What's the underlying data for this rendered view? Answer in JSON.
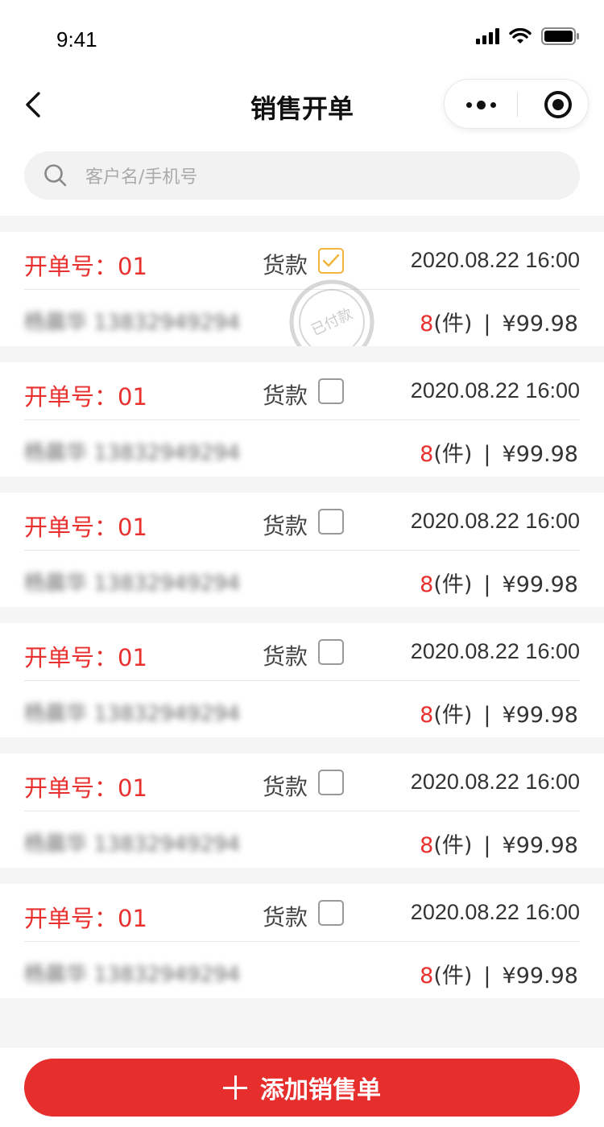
{
  "status_bar": {
    "time": "9:41",
    "icons": [
      "signal-icon",
      "wifi-icon",
      "battery-icon"
    ]
  },
  "nav": {
    "title": "销售开单",
    "icons": [
      "back-icon",
      "more-icon",
      "close-mini-program-icon"
    ]
  },
  "search": {
    "placeholder": "客户名/手机号",
    "icon": "search-icon"
  },
  "orders": [
    {
      "order_label": "开单号：01",
      "payment_label": "货款",
      "paid": true,
      "stamp": "已付款",
      "date": "2020.08.22 16:00",
      "customer": "杨晨华  13832949294",
      "qty": "8",
      "unit": "(件)",
      "separator": "|",
      "amount": "¥99.98"
    },
    {
      "order_label": "开单号：01",
      "payment_label": "货款",
      "paid": false,
      "date": "2020.08.22 16:00",
      "customer": "杨晨华  13832949294",
      "qty": "8",
      "unit": "(件)",
      "separator": "|",
      "amount": "¥99.98"
    },
    {
      "order_label": "开单号：01",
      "payment_label": "货款",
      "paid": false,
      "date": "2020.08.22 16:00",
      "customer": "杨晨华  13832949294",
      "qty": "8",
      "unit": "(件)",
      "separator": "|",
      "amount": "¥99.98"
    },
    {
      "order_label": "开单号：01",
      "payment_label": "货款",
      "paid": false,
      "date": "2020.08.22 16:00",
      "customer": "杨晨华  13832949294",
      "qty": "8",
      "unit": "(件)",
      "separator": "|",
      "amount": "¥99.98"
    },
    {
      "order_label": "开单号：01",
      "payment_label": "货款",
      "paid": false,
      "date": "2020.08.22 16:00",
      "customer": "杨晨华  13832949294",
      "qty": "8",
      "unit": "(件)",
      "separator": "|",
      "amount": "¥99.98"
    },
    {
      "order_label": "开单号：01",
      "payment_label": "货款",
      "paid": false,
      "date": "2020.08.22 16:00",
      "customer": "杨晨华  13832949294",
      "qty": "8",
      "unit": "(件)",
      "separator": "|",
      "amount": "¥99.98"
    }
  ],
  "footer": {
    "add_button_label": "添加销售单",
    "icon": "plus-icon"
  },
  "colors": {
    "accent": "#e62e2d",
    "checked": "#f0b43a",
    "text": "#333333",
    "background": "#f5f5f5"
  }
}
